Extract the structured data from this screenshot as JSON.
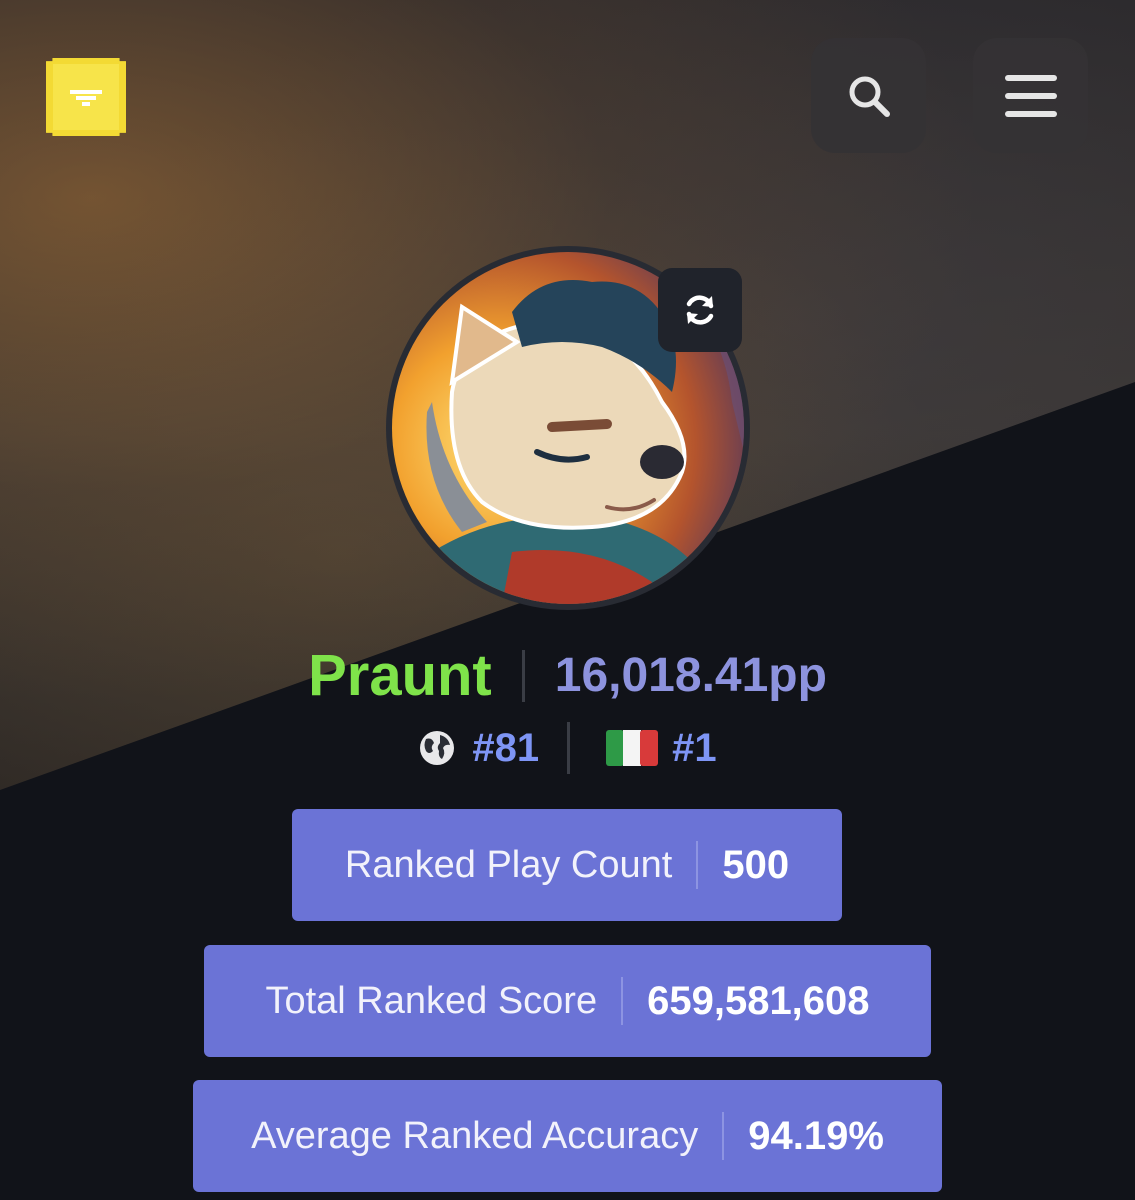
{
  "header": {
    "logo_icon": "beatleader-logo-icon",
    "search_icon": "search-icon",
    "menu_icon": "hamburger-menu-icon"
  },
  "profile": {
    "avatar_icon": "user-avatar",
    "refresh_icon": "refresh-icon",
    "username": "Praunt",
    "pp": "16,018.41pp",
    "global_rank": "#81",
    "country_rank": "#1",
    "country_flag": "italy-flag-icon"
  },
  "stats": [
    {
      "label": "Ranked Play Count",
      "value": "500"
    },
    {
      "label": "Total Ranked Score",
      "value": "659,581,608"
    },
    {
      "label": "Average Ranked Accuracy",
      "value": "94.19%"
    }
  ],
  "colors": {
    "username": "#7fe34a",
    "pp": "#8d93de",
    "rank": "#7e95f5",
    "stat_bg": "#6b73d6",
    "logo": "#f3da34"
  }
}
